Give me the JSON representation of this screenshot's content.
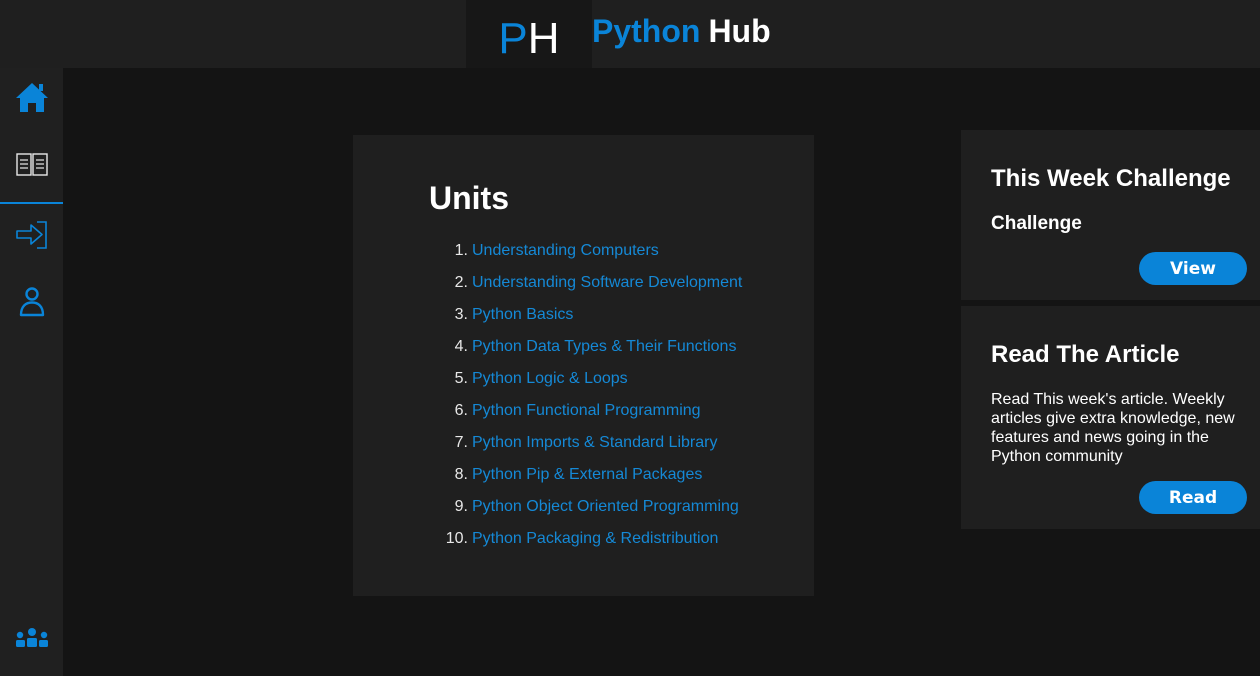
{
  "header": {
    "logo_letter_1": "P",
    "logo_letter_2": "H",
    "brand_word_1": "Python",
    "brand_word_2": "Hub"
  },
  "sidebar": {
    "items": [
      {
        "name": "home",
        "icon": "home-icon"
      },
      {
        "name": "units",
        "icon": "book-icon",
        "active": true
      },
      {
        "name": "login",
        "icon": "login-icon"
      },
      {
        "name": "profile",
        "icon": "user-icon"
      },
      {
        "name": "community",
        "icon": "group-icon"
      }
    ]
  },
  "units": {
    "title": "Units",
    "items": [
      {
        "num": "1.",
        "label": "Understanding Computers"
      },
      {
        "num": "2.",
        "label": "Understanding Software Development"
      },
      {
        "num": "3.",
        "label": "Python Basics"
      },
      {
        "num": "4.",
        "label": "Python Data Types & Their Functions"
      },
      {
        "num": "5.",
        "label": "Python Logic & Loops"
      },
      {
        "num": "6.",
        "label": "Python Functional Programming"
      },
      {
        "num": "7.",
        "label": "Python Imports & Standard Library"
      },
      {
        "num": "8.",
        "label": "Python Pip & External Packages"
      },
      {
        "num": "9.",
        "label": "Python Object Oriented Programming"
      },
      {
        "num": "10.",
        "label": "Python Packaging & Redistribution"
      }
    ]
  },
  "challenge": {
    "title": "This Week Challenge",
    "subtitle": "Challenge",
    "button": "View"
  },
  "article": {
    "title": "Read The Article",
    "text": "Read This week's article. Weekly articles give extra knowledge, new features and news going in the Python community",
    "button": "Read"
  },
  "colors": {
    "accent": "#0a84d8",
    "background": "#141414",
    "panel": "#1f1f1f"
  }
}
